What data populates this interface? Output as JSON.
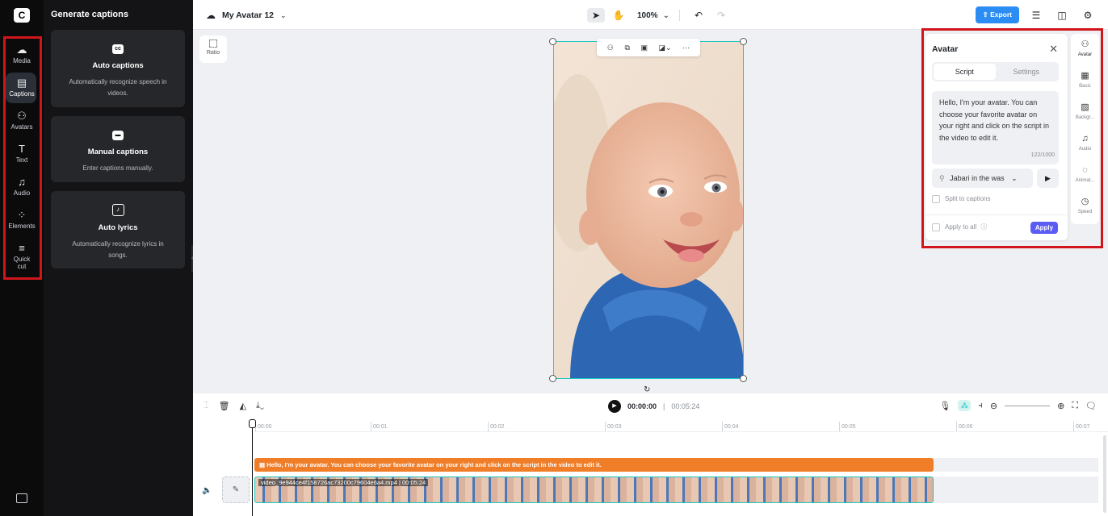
{
  "rail": {
    "logo": "C",
    "items": [
      {
        "label": "Media",
        "icon": "cloud-icon",
        "glyph": "☁"
      },
      {
        "label": "Captions",
        "icon": "captions-icon",
        "glyph": "▤"
      },
      {
        "label": "Avatars",
        "icon": "avatar-icon",
        "glyph": "⚇"
      },
      {
        "label": "Text",
        "icon": "text-icon",
        "glyph": "T"
      },
      {
        "label": "Audio",
        "icon": "music-icon",
        "glyph": "♫"
      },
      {
        "label": "Elements",
        "icon": "elements-icon",
        "glyph": "⁘"
      },
      {
        "label": "Quick cut",
        "icon": "quick-cut-icon",
        "glyph": "≡"
      }
    ],
    "active": "Captions"
  },
  "panel": {
    "title": "Generate captions",
    "cards": [
      {
        "icon": "cc",
        "title": "Auto captions",
        "desc": "Automatically recognize speech in videos."
      },
      {
        "icon": "▬",
        "title": "Manual captions",
        "desc": "Enter captions manually."
      },
      {
        "icon": "♪",
        "title": "Auto lyrics",
        "desc": "Automatically recognize lyrics in songs."
      }
    ]
  },
  "topbar": {
    "project_name": "My Avatar 12",
    "zoom": "100%",
    "export_label": "Export"
  },
  "canvas": {
    "ratio_label": "Ratio"
  },
  "avatar_panel": {
    "title": "Avatar",
    "tabs": [
      "Script",
      "Settings"
    ],
    "active_tab": "Script",
    "script_text": "Hello, I'm your avatar. You can choose your favorite avatar on your right and click on the script in the video to edit it.",
    "char_count": "122/1000",
    "voice": "Jabari in the was",
    "split_label": "Split to captions",
    "apply_all_label": "Apply to all",
    "apply_label": "Apply"
  },
  "right_bar": {
    "items": [
      {
        "label": "Avatar",
        "glyph": "⚇"
      },
      {
        "label": "Basic",
        "glyph": "▦"
      },
      {
        "label": "Backgr...",
        "glyph": "▨"
      },
      {
        "label": "Audio",
        "glyph": "♫"
      },
      {
        "label": "Animat...",
        "glyph": "◌"
      },
      {
        "label": "Speed",
        "glyph": "◷"
      }
    ]
  },
  "timeline": {
    "current_time": "00:00:00",
    "total_time": "00:05:24",
    "ticks": [
      "00:00",
      "00:01",
      "00:02",
      "00:03",
      "00:04",
      "00:05",
      "00:06",
      "00:07"
    ],
    "caption_clip": "Hello, I'm your avatar. You can choose your favorite avatar on your right and click on the script in the video to edit it.",
    "video_clip": "video_9e944ce4f158726ac73200c79604e6a4.mp4 | 00:05:24"
  },
  "colors": {
    "accent": "#2b8cf4",
    "apply": "#5b5cf6",
    "caption_track": "#f07d28",
    "selection": "#1fc7c0",
    "highlight": "#d0151b"
  }
}
